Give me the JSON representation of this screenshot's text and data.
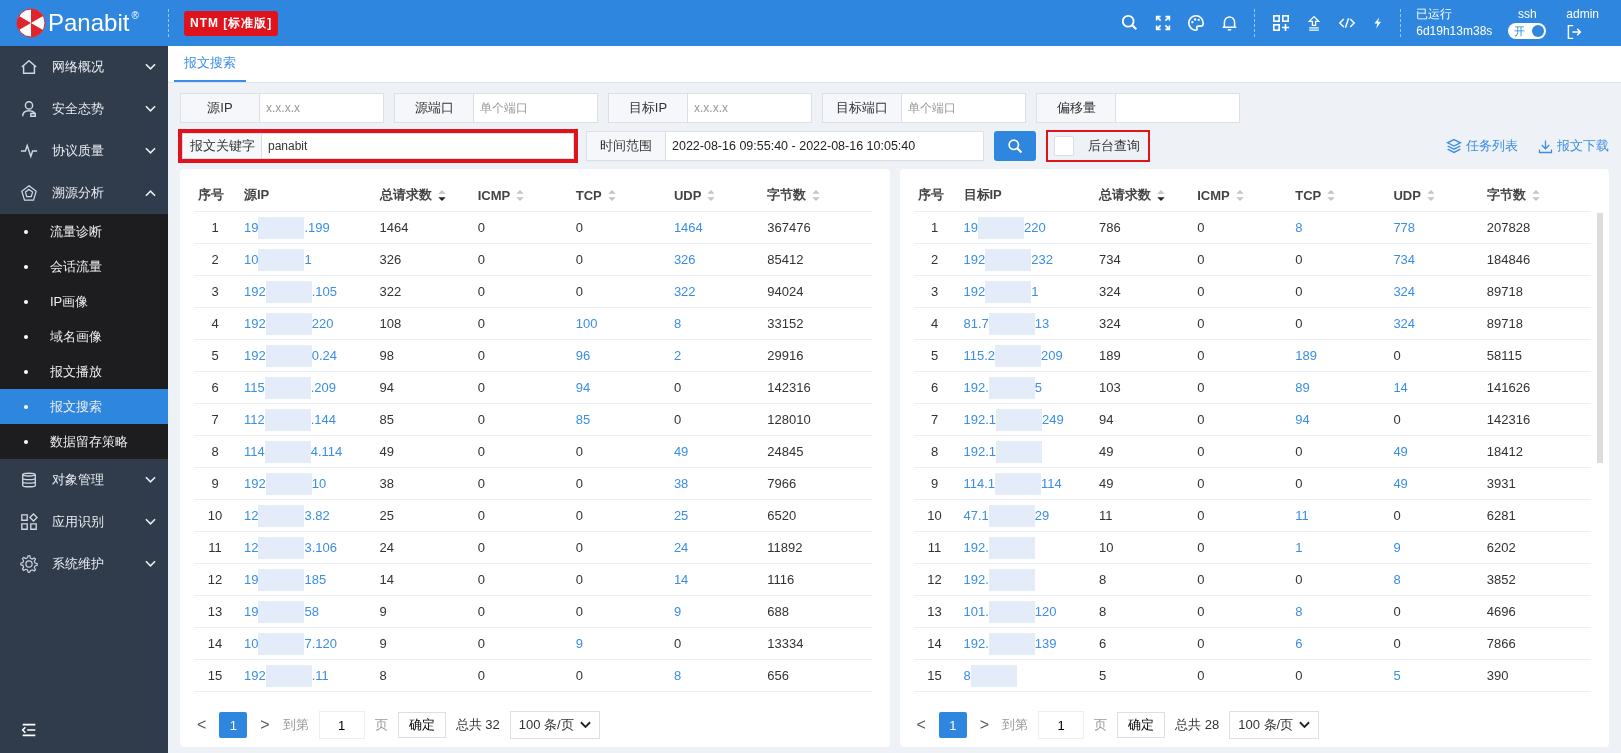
{
  "header": {
    "logo": "Panabit",
    "logo_mark": "®",
    "edition": "NTM [标准版]",
    "uptime_label": "已运行",
    "uptime": "6d19h13m38s",
    "ssh_label": "ssh",
    "ssh_toggle": {
      "text": "开",
      "on": true
    },
    "user": "admin"
  },
  "sidebar": {
    "items": [
      {
        "label": "网络概况",
        "expanded": false
      },
      {
        "label": "安全态势",
        "expanded": false
      },
      {
        "label": "协议质量",
        "expanded": false
      },
      {
        "label": "溯源分析",
        "expanded": true,
        "children": [
          {
            "label": "流量诊断",
            "selected": false
          },
          {
            "label": "会话流量",
            "selected": false
          },
          {
            "label": "IP画像",
            "selected": false
          },
          {
            "label": "域名画像",
            "selected": false
          },
          {
            "label": "报文播放",
            "selected": false
          },
          {
            "label": "报文搜索",
            "selected": true
          },
          {
            "label": "数据留存策略",
            "selected": false
          }
        ]
      },
      {
        "label": "对象管理",
        "expanded": false
      },
      {
        "label": "应用识别",
        "expanded": false
      },
      {
        "label": "系统维护",
        "expanded": false
      }
    ]
  },
  "tabs": [
    {
      "label": "报文搜索",
      "selected": true
    }
  ],
  "filters": {
    "row1": [
      {
        "label": "源IP",
        "placeholder": "x.x.x.x"
      },
      {
        "label": "源端口",
        "placeholder": "单个端口"
      },
      {
        "label": "目标IP",
        "placeholder": "x.x.x.x"
      },
      {
        "label": "目标端口",
        "placeholder": "单个端口"
      },
      {
        "label": "偏移量"
      }
    ],
    "keyword": {
      "label": "报文关键字",
      "value": "panabit",
      "highlighted": true
    },
    "time_range": {
      "label": "时间范围",
      "value": "2022-08-16 09:55:40 - 2022-08-16 10:05:40"
    },
    "background_query": {
      "label": "后台查询",
      "checked": false,
      "highlighted": true
    },
    "links": [
      {
        "label": "任务列表"
      },
      {
        "label": "报文下载"
      }
    ]
  },
  "tables": [
    {
      "columns": [
        {
          "label": "序号"
        },
        {
          "label": "源IP"
        },
        {
          "label": "总请求数",
          "sortable": true,
          "sorted": true
        },
        {
          "label": "ICMP",
          "sortable": true,
          "sorted": false
        },
        {
          "label": "TCP",
          "sortable": true,
          "sorted": false
        },
        {
          "label": "UDP",
          "sortable": true,
          "sorted": false
        },
        {
          "label": "字节数",
          "sortable": true,
          "sorted": false
        }
      ],
      "scrollbar": false,
      "rows": [
        {
          "no": "1",
          "ip_head": "19",
          "ip_tail": ".199",
          "total": "1464",
          "icmp": "0",
          "tcp": "0",
          "udp": "1464",
          "bytes": "367476"
        },
        {
          "no": "2",
          "ip_head": "10",
          "ip_tail": "1",
          "total": "326",
          "icmp": "0",
          "tcp": "0",
          "udp": "326",
          "bytes": "85412"
        },
        {
          "no": "3",
          "ip_head": "192",
          "ip_tail": ".105",
          "total": "322",
          "icmp": "0",
          "tcp": "0",
          "udp": "322",
          "bytes": "94024"
        },
        {
          "no": "4",
          "ip_head": "192",
          "ip_tail": "220",
          "total": "108",
          "icmp": "0",
          "tcp": "100",
          "udp": "8",
          "bytes": "33152"
        },
        {
          "no": "5",
          "ip_head": "192",
          "ip_tail": "0.24",
          "total": "98",
          "icmp": "0",
          "tcp": "96",
          "udp": "2",
          "bytes": "29916"
        },
        {
          "no": "6",
          "ip_head": "115",
          "ip_tail": ".209",
          "total": "94",
          "icmp": "0",
          "tcp": "94",
          "udp": "0",
          "bytes": "142316"
        },
        {
          "no": "7",
          "ip_head": "112",
          "ip_tail": ".144",
          "total": "85",
          "icmp": "0",
          "tcp": "85",
          "udp": "0",
          "bytes": "128010"
        },
        {
          "no": "8",
          "ip_head": "114",
          "ip_tail": "4.114",
          "total": "49",
          "icmp": "0",
          "tcp": "0",
          "udp": "49",
          "bytes": "24845"
        },
        {
          "no": "9",
          "ip_head": "192",
          "ip_tail": "10",
          "total": "38",
          "icmp": "0",
          "tcp": "0",
          "udp": "38",
          "bytes": "7966"
        },
        {
          "no": "10",
          "ip_head": "12",
          "ip_tail": "3.82",
          "total": "25",
          "icmp": "0",
          "tcp": "0",
          "udp": "25",
          "bytes": "6520"
        },
        {
          "no": "11",
          "ip_head": "12",
          "ip_tail": "3.106",
          "total": "24",
          "icmp": "0",
          "tcp": "0",
          "udp": "24",
          "bytes": "11892"
        },
        {
          "no": "12",
          "ip_head": "19",
          "ip_tail": "185",
          "total": "14",
          "icmp": "0",
          "tcp": "0",
          "udp": "14",
          "bytes": "1116"
        },
        {
          "no": "13",
          "ip_head": "19",
          "ip_tail": "58",
          "total": "9",
          "icmp": "0",
          "tcp": "0",
          "udp": "9",
          "bytes": "688"
        },
        {
          "no": "14",
          "ip_head": "10",
          "ip_tail": "7.120",
          "total": "9",
          "icmp": "0",
          "tcp": "9",
          "udp": "0",
          "bytes": "13334"
        },
        {
          "no": "15",
          "ip_head": "192",
          "ip_tail": ".11",
          "total": "8",
          "icmp": "0",
          "tcp": "0",
          "udp": "8",
          "bytes": "656"
        }
      ],
      "pagination": {
        "prev": "<",
        "page": "1",
        "next": ">",
        "goto_label": "到第",
        "goto_value": "1",
        "page_unit": "页",
        "confirm": "确定",
        "total": "总共 32",
        "page_size": "100 条/页"
      }
    },
    {
      "columns": [
        {
          "label": "序号"
        },
        {
          "label": "目标IP"
        },
        {
          "label": "总请求数",
          "sortable": true,
          "sorted": true
        },
        {
          "label": "ICMP",
          "sortable": true,
          "sorted": false
        },
        {
          "label": "TCP",
          "sortable": true,
          "sorted": false
        },
        {
          "label": "UDP",
          "sortable": true,
          "sorted": false
        },
        {
          "label": "字节数",
          "sortable": true,
          "sorted": false
        }
      ],
      "scrollbar": true,
      "rows": [
        {
          "no": "1",
          "ip_head": "19",
          "ip_tail": "220",
          "total": "786",
          "icmp": "0",
          "tcp": "8",
          "udp": "778",
          "bytes": "207828"
        },
        {
          "no": "2",
          "ip_head": "192",
          "ip_tail": "232",
          "total": "734",
          "icmp": "0",
          "tcp": "0",
          "udp": "734",
          "bytes": "184846"
        },
        {
          "no": "3",
          "ip_head": "192",
          "ip_tail": "1",
          "total": "324",
          "icmp": "0",
          "tcp": "0",
          "udp": "324",
          "bytes": "89718"
        },
        {
          "no": "4",
          "ip_head": "81.7",
          "ip_tail": "13",
          "total": "324",
          "icmp": "0",
          "tcp": "0",
          "udp": "324",
          "bytes": "89718"
        },
        {
          "no": "5",
          "ip_head": "115.2",
          "ip_tail": "209",
          "total": "189",
          "icmp": "0",
          "tcp": "189",
          "udp": "0",
          "bytes": "58115"
        },
        {
          "no": "6",
          "ip_head": "192.",
          "ip_tail": "5",
          "total": "103",
          "icmp": "0",
          "tcp": "89",
          "udp": "14",
          "bytes": "141626"
        },
        {
          "no": "7",
          "ip_head": "192.1",
          "ip_tail": "249",
          "total": "94",
          "icmp": "0",
          "tcp": "94",
          "udp": "0",
          "bytes": "142316"
        },
        {
          "no": "8",
          "ip_head": "192.1",
          "ip_tail": "",
          "total": "49",
          "icmp": "0",
          "tcp": "0",
          "udp": "49",
          "bytes": "18412"
        },
        {
          "no": "9",
          "ip_head": "114.1",
          "ip_tail": "114",
          "total": "49",
          "icmp": "0",
          "tcp": "0",
          "udp": "49",
          "bytes": "3931"
        },
        {
          "no": "10",
          "ip_head": "47.1",
          "ip_tail": "29",
          "total": "11",
          "icmp": "0",
          "tcp": "11",
          "udp": "0",
          "bytes": "6281"
        },
        {
          "no": "11",
          "ip_head": "192.",
          "ip_tail": "",
          "total": "10",
          "icmp": "0",
          "tcp": "1",
          "udp": "9",
          "bytes": "6202"
        },
        {
          "no": "12",
          "ip_head": "192.",
          "ip_tail": "",
          "total": "8",
          "icmp": "0",
          "tcp": "0",
          "udp": "8",
          "bytes": "3852"
        },
        {
          "no": "13",
          "ip_head": "101.",
          "ip_tail": "120",
          "total": "8",
          "icmp": "0",
          "tcp": "8",
          "udp": "0",
          "bytes": "4696"
        },
        {
          "no": "14",
          "ip_head": "192.",
          "ip_tail": "139",
          "total": "6",
          "icmp": "0",
          "tcp": "6",
          "udp": "0",
          "bytes": "7866"
        },
        {
          "no": "15",
          "ip_head": "8",
          "ip_tail": "",
          "total": "5",
          "icmp": "0",
          "tcp": "0",
          "udp": "5",
          "bytes": "390"
        }
      ],
      "pagination": {
        "prev": "<",
        "page": "1",
        "next": ">",
        "goto_label": "到第",
        "goto_value": "1",
        "page_unit": "页",
        "confirm": "确定",
        "total": "总共 28",
        "page_size": "100 条/页"
      }
    }
  ]
}
